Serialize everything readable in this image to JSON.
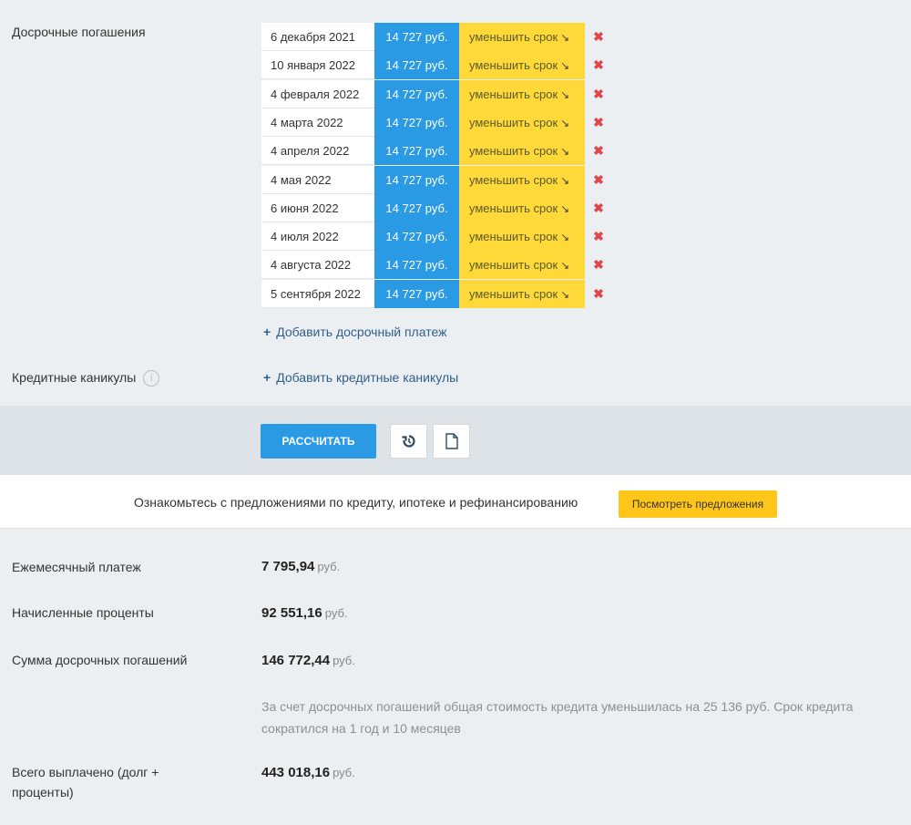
{
  "early_repayments": {
    "label": "Досрочные погашения",
    "rows": [
      {
        "date": "6 декабря 2021",
        "amount": "14 727 руб.",
        "mode": "уменьшить срок"
      },
      {
        "date": "10 января 2022",
        "amount": "14 727 руб.",
        "mode": "уменьшить срок"
      },
      {
        "date": "4 февраля 2022",
        "amount": "14 727 руб.",
        "mode": "уменьшить срок"
      },
      {
        "date": "4 марта 2022",
        "amount": "14 727 руб.",
        "mode": "уменьшить срок"
      },
      {
        "date": "4 апреля 2022",
        "amount": "14 727 руб.",
        "mode": "уменьшить срок"
      },
      {
        "date": "4 мая 2022",
        "amount": "14 727 руб.",
        "mode": "уменьшить срок"
      },
      {
        "date": "6 июня 2022",
        "amount": "14 727 руб.",
        "mode": "уменьшить срок"
      },
      {
        "date": "4 июля 2022",
        "amount": "14 727 руб.",
        "mode": "уменьшить срок"
      },
      {
        "date": "4 августа 2022",
        "amount": "14 727 руб.",
        "mode": "уменьшить срок"
      },
      {
        "date": "5 сентября 2022",
        "amount": "14 727 руб.",
        "mode": "уменьшить срок"
      }
    ],
    "add_label": "Добавить досрочный платеж"
  },
  "holidays": {
    "label": "Кредитные каникулы",
    "add_label": "Добавить кредитные каникулы"
  },
  "actions": {
    "calculate_label": "РАССЧИТАТЬ"
  },
  "offer": {
    "text": "Ознакомьтесь с предложениями по кредиту, ипотеке и рефинансированию",
    "button_label": "Посмотреть предложения"
  },
  "results": {
    "currency": "руб.",
    "monthly_payment": {
      "label": "Ежемесячный платеж",
      "value": "7 795,94"
    },
    "interest": {
      "label": "Начисленные проценты",
      "value": "92 551,16"
    },
    "early_total": {
      "label": "Сумма досрочных погашений",
      "value": "146 772,44"
    },
    "note": "За счет досрочных погашений общая стоимость кредита уменьшилась на 25 136 руб. Срок кредита сократился на 1 год и 10 месяцев",
    "total_paid": {
      "label": "Всего выплачено (долг + проценты)",
      "value": "443 018,16"
    }
  }
}
